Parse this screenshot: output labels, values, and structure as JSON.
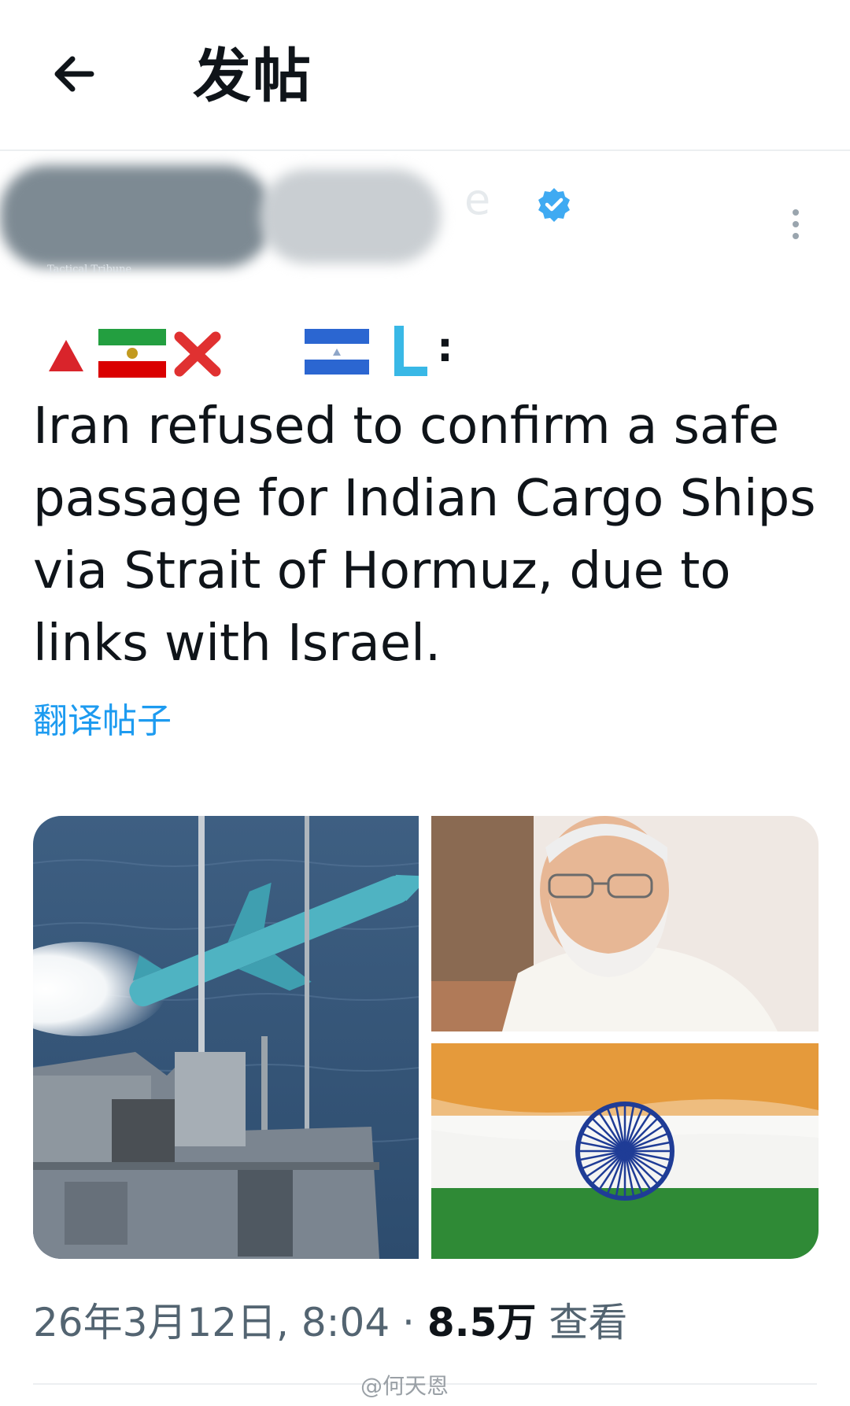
{
  "header": {
    "title": "发帖",
    "back_icon": "arrow-left-icon"
  },
  "author": {
    "verified_icon": "verified-badge-icon",
    "more_icon": "more-vertical-icon",
    "avatar_text": "Tactical Tribune"
  },
  "tweet": {
    "prefix_icons": [
      "red-triangle-icon",
      "iran-flag-icon",
      "cross-mark-icon",
      "nicaragua-flag-icon",
      "letter-l-icon"
    ],
    "prefix_separator": ":",
    "text": "Iran refused to confirm a safe passage for Indian Cargo Ships via Strait of Hormuz, due to links with Israel.",
    "translate_label": "翻译帖子"
  },
  "media": [
    {
      "name": "missile-launch-photo"
    },
    {
      "name": "modi-portrait-photo"
    },
    {
      "name": "india-flag-photo"
    }
  ],
  "meta": {
    "timestamp": "26年3月12日, 8:04",
    "separator": "·",
    "views_count": "8.5万",
    "views_label": "查看"
  },
  "watermark": "@何天恩",
  "colors": {
    "accent": "#1d9bf0",
    "text": "#0f1419",
    "muted": "#536471"
  }
}
